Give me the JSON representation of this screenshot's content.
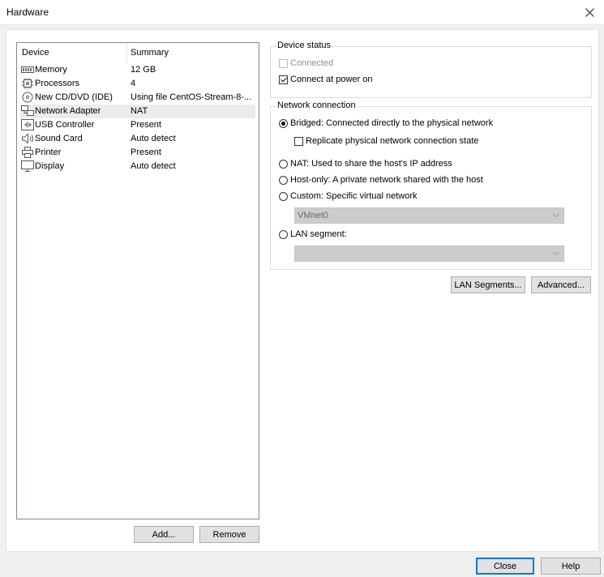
{
  "window": {
    "title": "Hardware"
  },
  "device_list": {
    "headers": {
      "device": "Device",
      "summary": "Summary"
    },
    "items": [
      {
        "name": "Memory",
        "summary": "12 GB",
        "icon": "memory-icon"
      },
      {
        "name": "Processors",
        "summary": "4",
        "icon": "processor-icon"
      },
      {
        "name": "New CD/DVD (IDE)",
        "summary": "Using file CentOS-Stream-8-...",
        "icon": "cd-dvd-icon"
      },
      {
        "name": "Network Adapter",
        "summary": "NAT",
        "icon": "network-adapter-icon",
        "selected": true
      },
      {
        "name": "USB Controller",
        "summary": "Present",
        "icon": "usb-icon"
      },
      {
        "name": "Sound Card",
        "summary": "Auto detect",
        "icon": "speaker-icon"
      },
      {
        "name": "Printer",
        "summary": "Present",
        "icon": "printer-icon"
      },
      {
        "name": "Display",
        "summary": "Auto detect",
        "icon": "monitor-icon"
      }
    ]
  },
  "buttons": {
    "add": "Add...",
    "remove": "Remove",
    "lan_segments": "LAN Segments...",
    "advanced": "Advanced...",
    "close": "Close",
    "help": "Help"
  },
  "device_status": {
    "legend": "Device status",
    "connected": {
      "label": "Connected",
      "checked": false,
      "disabled": true
    },
    "connect_at_power_on": {
      "label": "Connect at power on",
      "checked": true
    }
  },
  "network_connection": {
    "legend": "Network connection",
    "bridged": "Bridged: Connected directly to the physical network",
    "replicate": "Replicate physical network connection state",
    "nat": "NAT: Used to share the host's IP address",
    "host_only": "Host-only: A private network shared with the host",
    "custom": "Custom: Specific virtual network",
    "custom_value": "VMnet0",
    "lan_segment": "LAN segment:",
    "lan_segment_value": "",
    "selected": "bridged"
  }
}
